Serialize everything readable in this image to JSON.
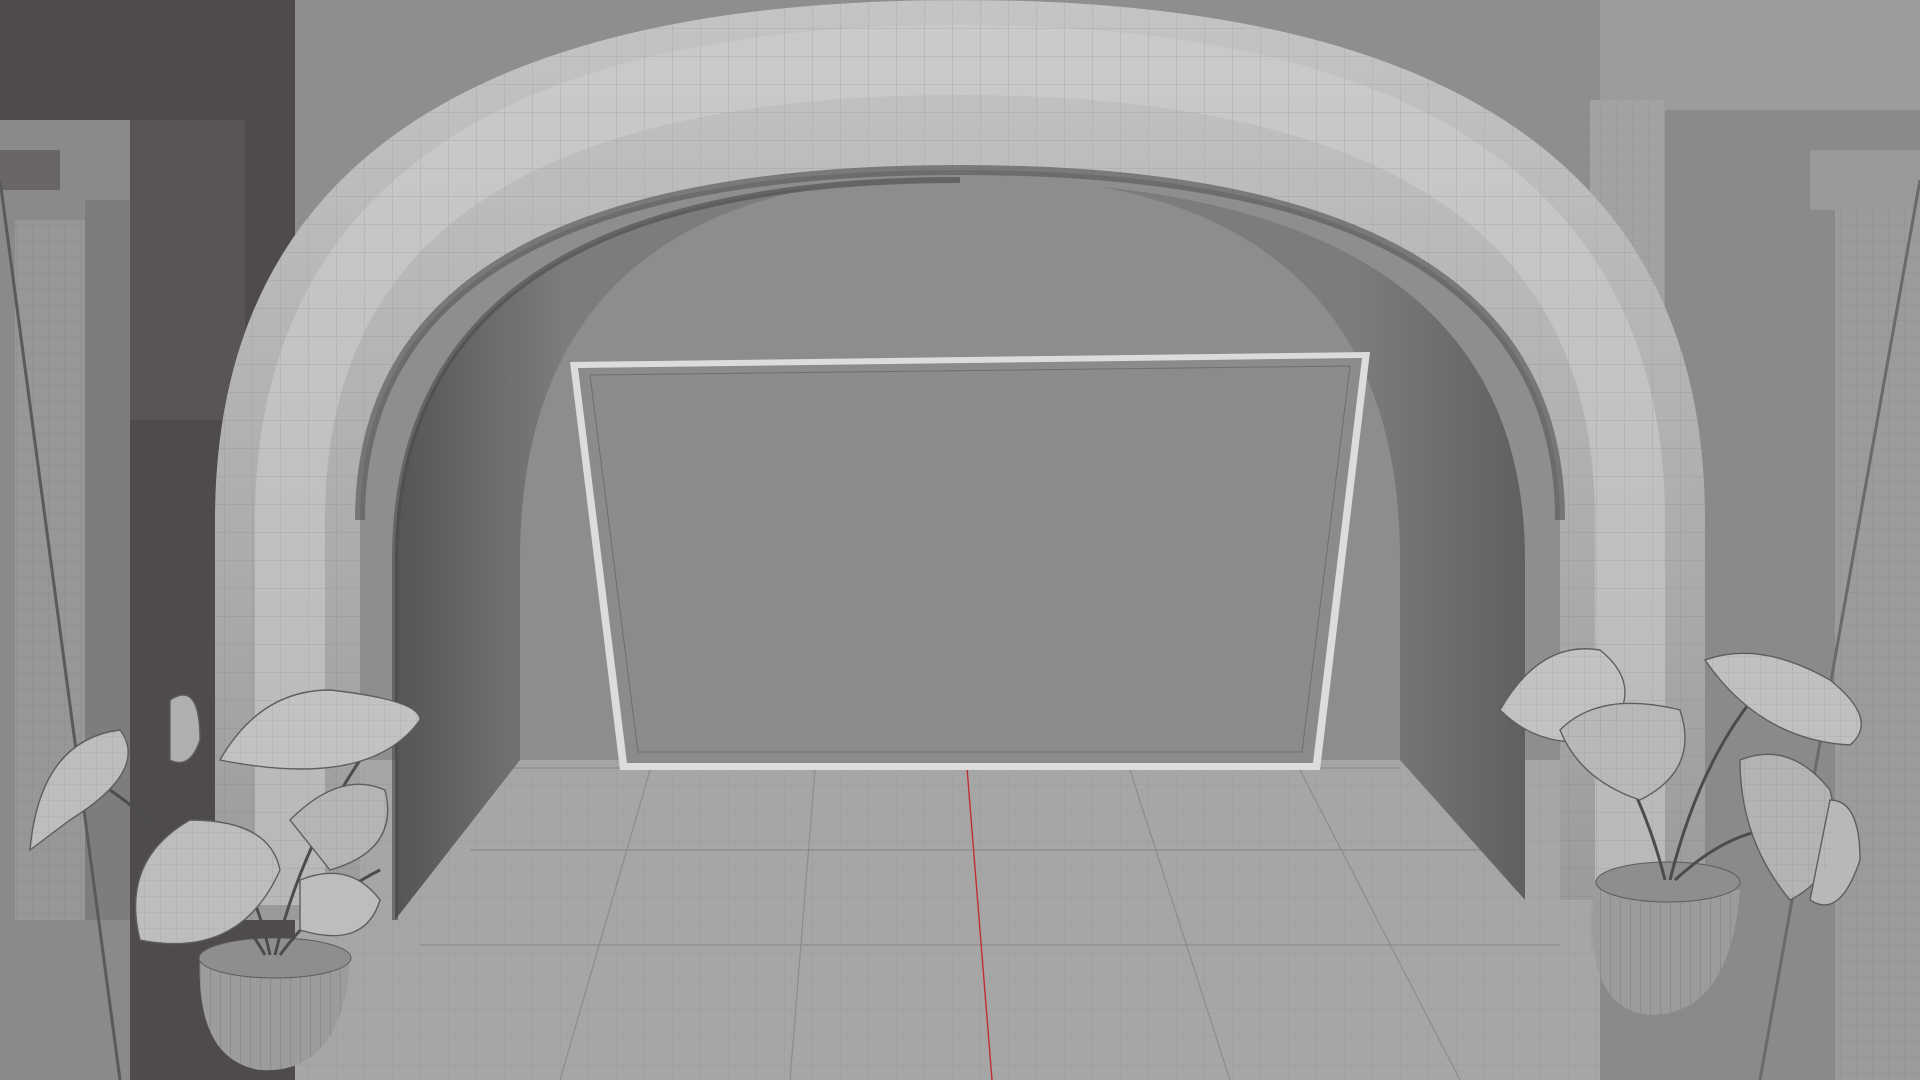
{
  "scene": {
    "palette": {
      "background": "#8d8d8d",
      "wall": "#8e8e8e",
      "floor": "#a4a4a4",
      "arch": "#b6b6b6",
      "arch_shadow": "#5a5a5a",
      "pillar_dark": "#4f4b4b",
      "panel": "#8b8b8b",
      "panel_frame": "#dcdcdc",
      "wire": "#7a7a7a",
      "axis_red": "#c03030",
      "leaf": "#bdbdbd",
      "pot": "#9c9c9c"
    },
    "objects": [
      "back-wall",
      "floor",
      "stone-arch",
      "wall-panel",
      "left-pillar",
      "right-pillar",
      "left-potted-plant",
      "right-potted-plant"
    ]
  }
}
